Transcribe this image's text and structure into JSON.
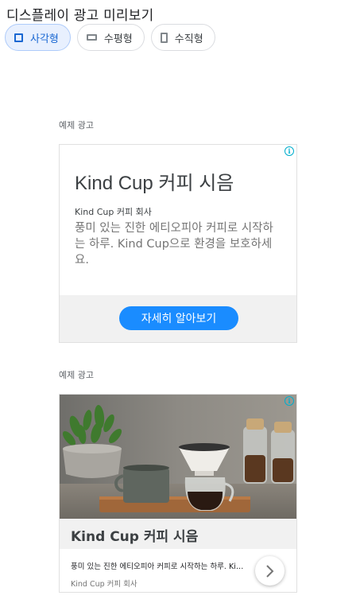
{
  "page": {
    "title": "디스플레이 광고 미리보기"
  },
  "format_tabs": [
    {
      "label": "사각형",
      "icon": "square-icon",
      "active": true
    },
    {
      "label": "수평형",
      "icon": "horizontal-rectangle-icon",
      "active": false
    },
    {
      "label": "수직형",
      "icon": "vertical-rectangle-icon",
      "active": false
    }
  ],
  "ad_text_preview": {
    "label": "예제 광고",
    "headline": "Kind Cup 커피 시음",
    "business_name": "Kind Cup 커피 회사",
    "description": "풍미 있는 진한 에티오피아 커피로 시작하는 하루. Kind Cup으로 환경을 보호하세요.",
    "cta_label": "자세히 알아보기",
    "info_icon": "info-icon",
    "cta_color": "#1a8cff"
  },
  "ad_image_preview": {
    "label": "예제 광고",
    "headline": "Kind Cup 커피 시음",
    "description": "풍미 있는 진한 에티오피아 커피로 시작하는 하루. Kind Cup으로 환경을 보호하세요.",
    "business_name": "Kind Cup 커피 회사",
    "info_icon": "info-icon",
    "next_icon": "chevron-right-icon"
  },
  "colors": {
    "accent": "#1967d2",
    "active_chip_bg": "#e8f0fe",
    "info_icon": "#00aecd"
  }
}
